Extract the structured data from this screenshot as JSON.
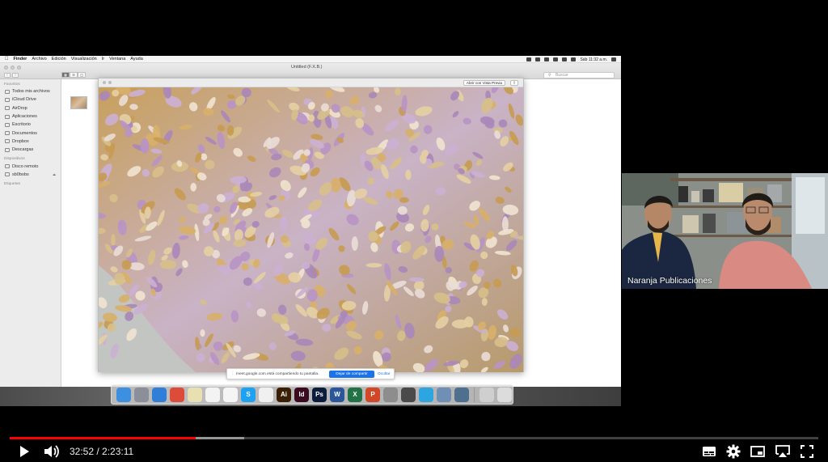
{
  "mac": {
    "menubar": {
      "app": "Finder",
      "items": [
        "Archivo",
        "Edición",
        "Visualización",
        "Ir",
        "Ventana",
        "Ayuda"
      ],
      "clock": "Sáb 11:32 a.m."
    },
    "finder": {
      "window_title": "Untitled (F.X.B.)",
      "search_placeholder": "Buscar",
      "sidebar": {
        "favorites_header": "Favoritos",
        "favorites": [
          {
            "label": "Todos mis archivos",
            "icon": "all-files-icon"
          },
          {
            "label": "iCloud Drive",
            "icon": "cloud-icon"
          },
          {
            "label": "AirDrop",
            "icon": "airdrop-icon"
          },
          {
            "label": "Aplicaciones",
            "icon": "applications-icon"
          },
          {
            "label": "Escritorio",
            "icon": "desktop-icon"
          },
          {
            "label": "Documentos",
            "icon": "documents-icon"
          },
          {
            "label": "Dropbox",
            "icon": "dropbox-icon"
          },
          {
            "label": "Descargas",
            "icon": "downloads-icon"
          }
        ],
        "devices_header": "Dispositivos",
        "devices": [
          {
            "label": "Disco remoto",
            "icon": "disk-icon"
          },
          {
            "label": "sb0bobs",
            "icon": "drive-icon"
          }
        ],
        "tags_header": "Etiquetas"
      }
    },
    "quicklook": {
      "open_with": "Abrir con Vista Previa"
    },
    "meet_banner": {
      "message": "meet.google.com está compartiendo tu pantalla.",
      "stop_label": "Dejar de compartir",
      "hide_label": "Ocultar"
    },
    "dock_apps": [
      {
        "name": "finder",
        "color": "#3d8fe0",
        "glyph": ""
      },
      {
        "name": "launchpad",
        "color": "#8a8f99",
        "glyph": ""
      },
      {
        "name": "safari",
        "color": "#2f7fd9",
        "glyph": ""
      },
      {
        "name": "chrome",
        "color": "#dd4b39",
        "glyph": ""
      },
      {
        "name": "notes",
        "color": "#e8e0b0",
        "glyph": ""
      },
      {
        "name": "textedit",
        "color": "#f3f3f3",
        "glyph": ""
      },
      {
        "name": "calendar",
        "color": "#f5f5f5",
        "glyph": ""
      },
      {
        "name": "skype",
        "color": "#1da1f2",
        "glyph": "S"
      },
      {
        "name": "itunes",
        "color": "#f0f0f0",
        "glyph": ""
      },
      {
        "name": "illustrator",
        "color": "#3a1f06",
        "glyph": "Ai"
      },
      {
        "name": "indesign",
        "color": "#3b0a1e",
        "glyph": "Id"
      },
      {
        "name": "photoshop",
        "color": "#0c1d3c",
        "glyph": "Ps"
      },
      {
        "name": "word",
        "color": "#2b579a",
        "glyph": "W"
      },
      {
        "name": "excel",
        "color": "#217346",
        "glyph": "X"
      },
      {
        "name": "powerpoint",
        "color": "#d24726",
        "glyph": "P"
      },
      {
        "name": "system-preferences",
        "color": "#8d8d8d",
        "glyph": ""
      },
      {
        "name": "photo-viewer",
        "color": "#4a4a4a",
        "glyph": ""
      },
      {
        "name": "telegram",
        "color": "#2ca5e0",
        "glyph": ""
      },
      {
        "name": "preview",
        "color": "#6f8fb4",
        "glyph": ""
      },
      {
        "name": "screen-sharing",
        "color": "#4f6f8f",
        "glyph": ""
      },
      {
        "name": "downloads-stack",
        "color": "#cfcfcf",
        "glyph": ""
      },
      {
        "name": "trash",
        "color": "#dcdcdc",
        "glyph": ""
      }
    ]
  },
  "participant": {
    "name": "Naranja Publicaciones"
  },
  "player": {
    "current_time": "32:52",
    "duration": "2:23:11",
    "time_display": "32:52 / 2:23:11",
    "played_fraction": 0.23,
    "buffered_fraction": 0.29,
    "accent": "#ff0000"
  }
}
